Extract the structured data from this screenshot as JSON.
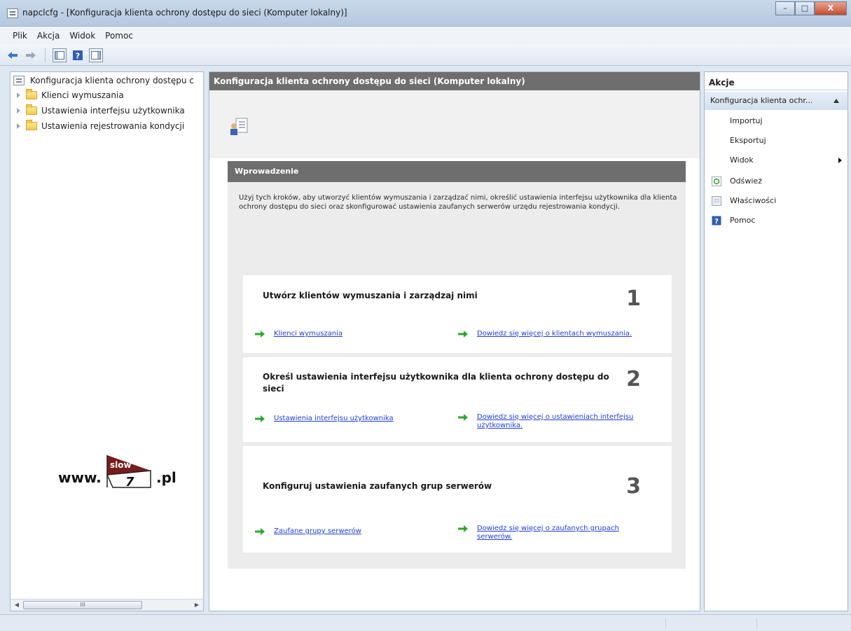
{
  "window": {
    "title": "napclcfg - [Konfiguracja klienta ochrony dostępu do sieci (Komputer lokalny)]",
    "minimize": "–",
    "maximize": "□",
    "close": "X"
  },
  "menu": [
    "Plik",
    "Akcja",
    "Widok",
    "Pomoc"
  ],
  "toolbar": {
    "icons": [
      "back-arrow-icon",
      "forward-arrow-icon",
      "show-hide-tree-icon",
      "help-icon",
      "action-pane-icon"
    ]
  },
  "tree": {
    "root": "Konfiguracja klienta ochrony dostępu c",
    "items": [
      "Klienci wymuszania",
      "Ustawienia interfejsu użytkownika",
      "Ustawienia rejestrowania kondycji"
    ]
  },
  "watermark": {
    "prefix": "www.",
    "flag_top": "slow",
    "flag_bottom": "7",
    "suffix": ".pl"
  },
  "scrollbar": {
    "grip": "III",
    "left": "◀",
    "right": "▶"
  },
  "center": {
    "header": "Konfiguracja klienta ochrony dostępu do sieci (Komputer lokalny)",
    "intro_header": "Wprowadzenie",
    "intro_text": "Użyj tych kroków, aby utworzyć klientów wymuszania i zarządzać nimi, określić ustawienia interfejsu użytkownika dla klienta ochrony dostępu do sieci oraz skonfigurować ustawienia zaufanych serwerów urzędu rejestrowania kondycji.",
    "steps": [
      {
        "title": "Utwórz klientów wymuszania i zarządzaj nimi",
        "number": "1",
        "link_left": "Klienci wymuszania",
        "link_right": "Dowiedz się więcej o klientach wymuszania."
      },
      {
        "title": "Określ ustawienia interfejsu użytkownika dla klienta ochrony dostępu do sieci",
        "number": "2",
        "link_left": "Ustawienia interfejsu użytkownika",
        "link_right": "Dowiedz się więcej o ustawieniach interfejsu użytkownika."
      },
      {
        "title": "Konfiguruj ustawienia zaufanych grup serwerów",
        "number": "3",
        "link_left": "Zaufane grupy serwerów",
        "link_right": "Dowiedz się więcej o zaufanych grupach serwerów."
      }
    ]
  },
  "actions": {
    "header": "Akcje",
    "section": "Konfiguracja klienta ochr...",
    "items": [
      "Importuj",
      "Eksportuj",
      "Widok",
      "Odśwież",
      "Właściwości",
      "Pomoc"
    ]
  },
  "colors": {
    "header_gray": "#6e6e6e",
    "link_blue": "#1f3fd8",
    "arrow_green": "#2ea62e"
  }
}
